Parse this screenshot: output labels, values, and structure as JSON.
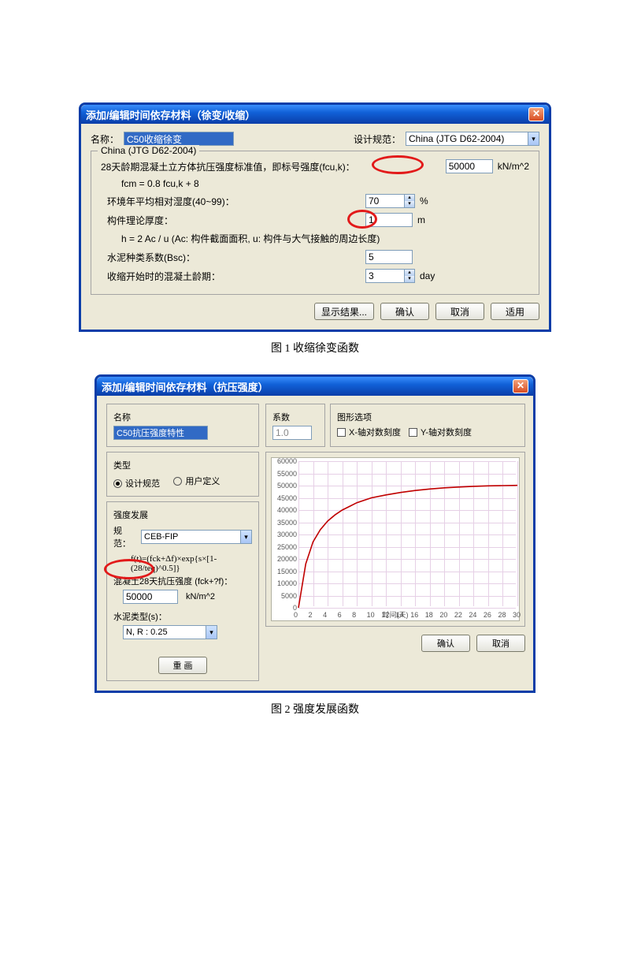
{
  "caption1": "图 1 收缩徐变函数",
  "caption2": "图 2 强度发展函数",
  "dialog1": {
    "title": "添加/编辑时间依存材料（徐变/收缩）",
    "name_label": "名称：",
    "name_value": "C50收缩徐变",
    "spec_label": "设计规范：",
    "spec_value": "China (JTG D62-2004)",
    "group_legend": "China (JTG D62-2004)",
    "r1_label": "28天龄期混凝土立方体抗压强度标准值，即标号强度(fcu,k)：",
    "r1_value": "50000",
    "r1_unit": "kN/m^2",
    "r1b_label": "fcm = 0.8 fcu,k + 8",
    "r2_label": "环境年平均相对湿度(40~99)：",
    "r2_value": "70",
    "r2_unit": "%",
    "r3_label": "构件理论厚度：",
    "r3_value": "1",
    "r3_unit": "m",
    "r3b_label": "h = 2 Ac / u (Ac: 构件截面面积, u: 构件与大气接触的周边长度)",
    "r4_label": "水泥种类系数(Bsc)：",
    "r4_value": "5",
    "r5_label": "收缩开始时的混凝土龄期：",
    "r5_value": "3",
    "r5_unit": "day",
    "btn_show": "显示结果...",
    "btn_ok": "确认",
    "btn_cancel": "取消",
    "btn_apply": "适用"
  },
  "dialog2": {
    "title": "添加/编辑时间依存材料（抗压强度）",
    "name_label": "名称",
    "name_value": "C50抗压强度特性",
    "type_legend": "类型",
    "type_opt1": "设计规范",
    "type_opt2": "用户定义",
    "dev_legend": "强度发展",
    "spec_label": "规范：",
    "spec_value": "CEB-FIP",
    "formula": "f(t)=(fck+Δf)×exp{s×[1-(28/teq)^0.5]}",
    "fck_label": "混凝土28天抗压强度 (fck+?f)：",
    "fck_value": "50000",
    "fck_unit": "kN/m^2",
    "cement_label": "水泥类型(s)：",
    "cement_value": "N, R : 0.25",
    "coef_label": "系数",
    "coef_value": "1.0",
    "graph_legend": "图形选项",
    "chk_xlog": "X-轴对数刻度",
    "chk_ylog": "Y-轴对数刻度",
    "chart_xlabel": "时间(天)",
    "btn_redraw": "重 画",
    "btn_ok": "确认",
    "btn_cancel": "取消"
  },
  "chart_data": {
    "type": "line",
    "xlabel": "时间(天)",
    "ylabel": "",
    "xlim": [
      0,
      30
    ],
    "ylim": [
      0,
      60000
    ],
    "x_ticks": [
      0,
      2,
      4,
      6,
      8,
      10,
      12,
      14,
      16,
      18,
      20,
      22,
      24,
      26,
      28,
      30
    ],
    "y_ticks": [
      0,
      5000,
      10000,
      15000,
      20000,
      25000,
      30000,
      35000,
      40000,
      45000,
      50000,
      55000,
      60000
    ],
    "x": [
      0,
      1,
      2,
      3,
      4,
      5,
      6,
      7,
      8,
      10,
      12,
      14,
      16,
      18,
      20,
      22,
      24,
      26,
      28,
      30
    ],
    "y": [
      0,
      18000,
      27000,
      32000,
      35500,
      38000,
      40000,
      41500,
      43000,
      45000,
      46200,
      47200,
      48000,
      48600,
      49100,
      49400,
      49700,
      49900,
      50000,
      50100
    ]
  }
}
